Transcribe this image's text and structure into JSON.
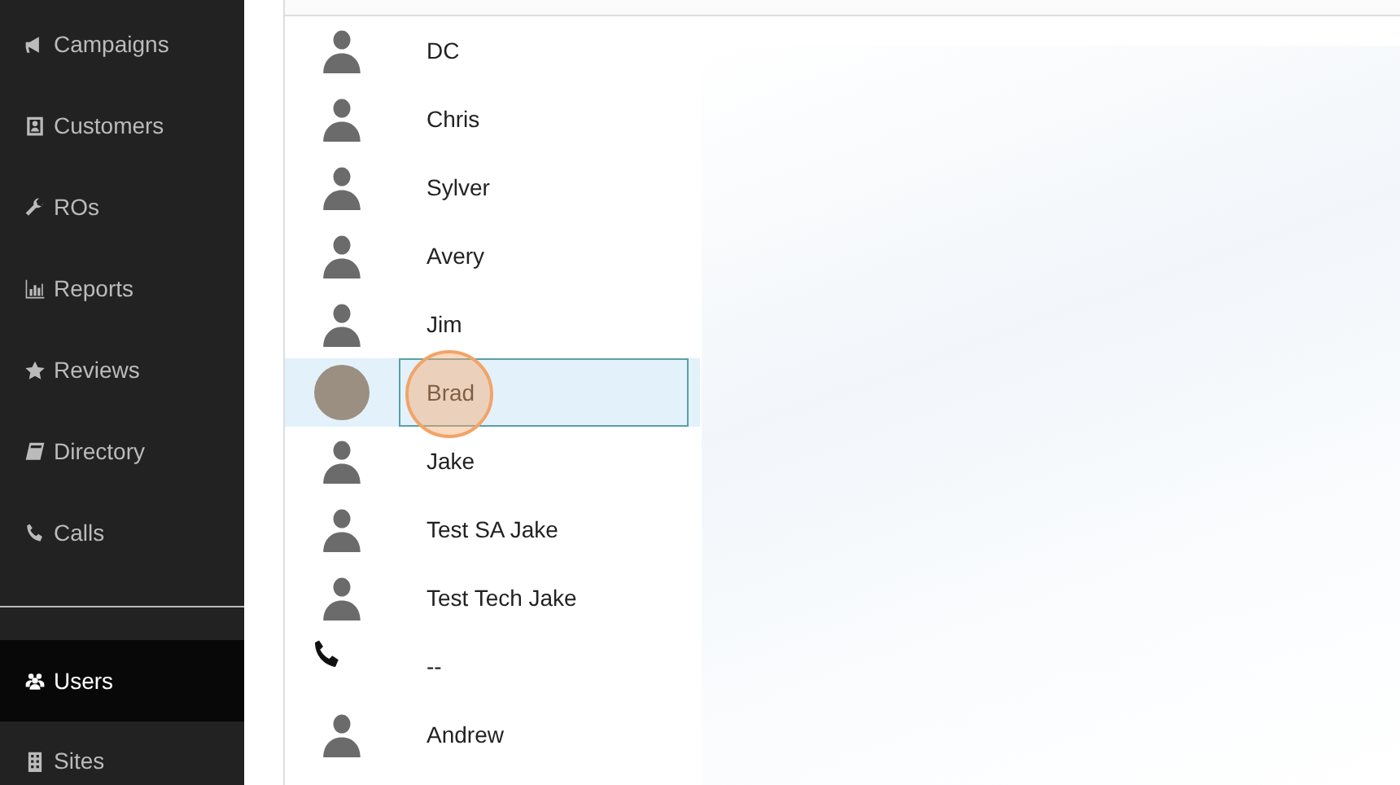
{
  "sidebar": {
    "items": [
      {
        "label": "Campaigns",
        "selected": false
      },
      {
        "label": "Customers",
        "selected": false
      },
      {
        "label": "ROs",
        "selected": false
      },
      {
        "label": "Reports",
        "selected": false
      },
      {
        "label": "Reviews",
        "selected": false
      },
      {
        "label": "Directory",
        "selected": false
      },
      {
        "label": "Calls",
        "selected": false
      }
    ],
    "admin_items": [
      {
        "label": "Users",
        "selected": true
      },
      {
        "label": "Sites",
        "selected": false
      }
    ]
  },
  "users": [
    {
      "name": "DC",
      "kind": "user",
      "selected": false,
      "clicked": false
    },
    {
      "name": "Chris",
      "kind": "user",
      "selected": false,
      "clicked": false
    },
    {
      "name": "Sylver",
      "kind": "user",
      "selected": false,
      "clicked": false
    },
    {
      "name": "Avery",
      "kind": "user",
      "selected": false,
      "clicked": false
    },
    {
      "name": "Jim",
      "kind": "user",
      "selected": false,
      "clicked": false
    },
    {
      "name": "Brad",
      "kind": "photo",
      "selected": true,
      "clicked": true
    },
    {
      "name": "Jake",
      "kind": "user",
      "selected": false,
      "clicked": false
    },
    {
      "name": "Test SA Jake",
      "kind": "user",
      "selected": false,
      "clicked": false
    },
    {
      "name": "Test Tech Jake",
      "kind": "user",
      "selected": false,
      "clicked": false
    },
    {
      "name": "--",
      "kind": "phone",
      "selected": false,
      "clicked": false
    },
    {
      "name": "Andrew",
      "kind": "user",
      "selected": false,
      "clicked": false
    }
  ]
}
